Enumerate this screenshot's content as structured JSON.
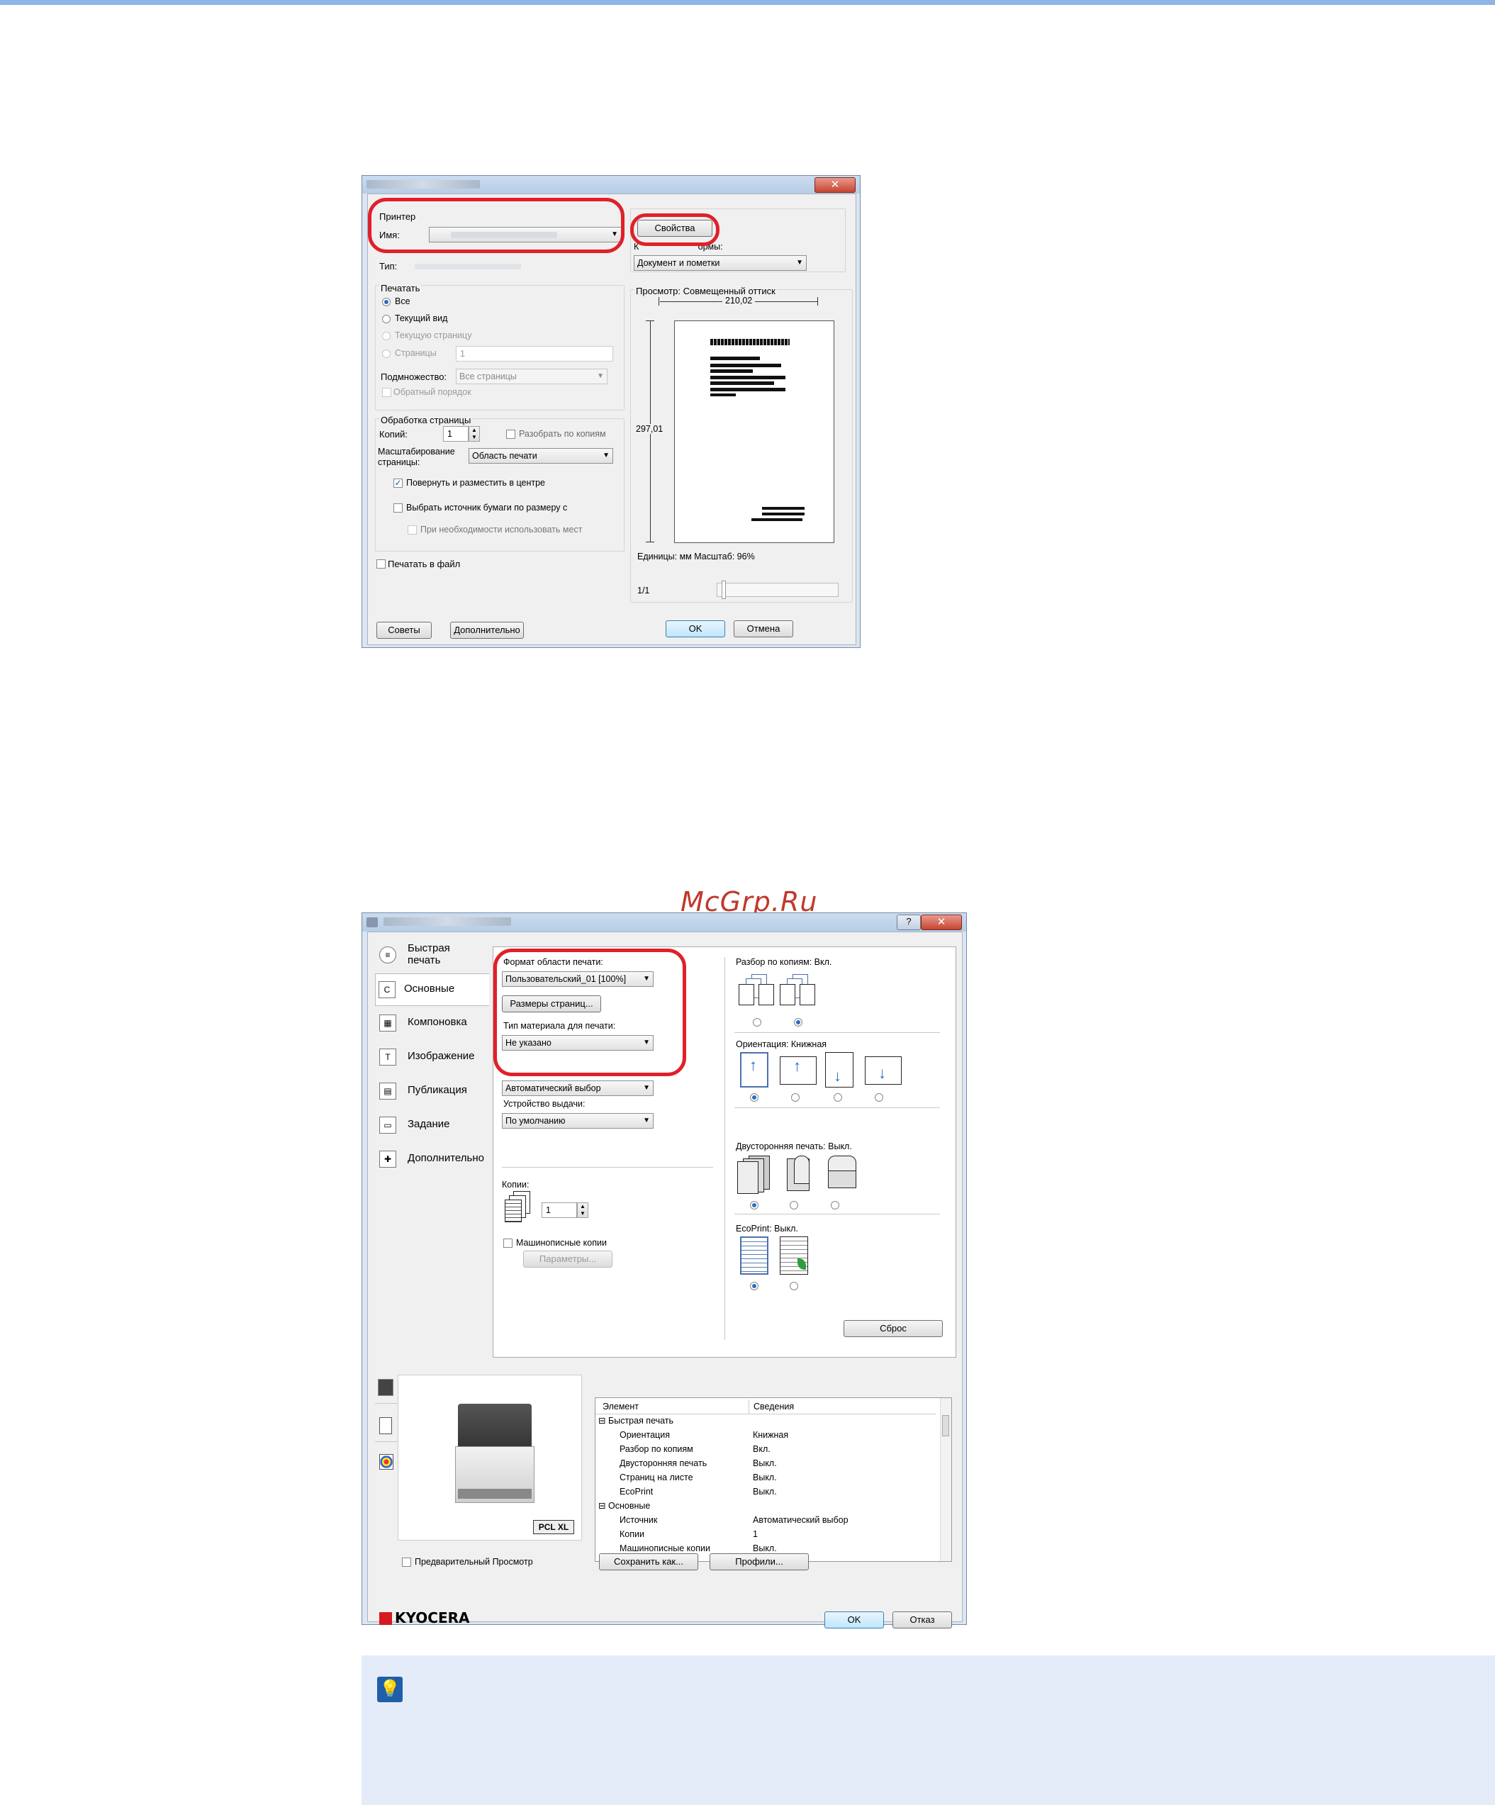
{
  "watermark": "McGrp.Ru",
  "print_dialog": {
    "printer_group": "Принтер",
    "name_label": "Имя:",
    "type_label": "Тип:",
    "properties_button": "Свойства",
    "comments_label_fragment": "К                        ормы:",
    "comments_value": "Документ и пометки",
    "print_range_group": "Печатать",
    "radio_all": "Все",
    "radio_current_view": "Текущий вид",
    "radio_current_page": "Текущую страницу",
    "radio_pages": "Страницы",
    "pages_value": "1",
    "subset_label": "Подмножество:",
    "subset_value": "Все страницы",
    "reverse_order": "Обратный порядок",
    "page_handling_group": "Обработка страницы",
    "copies_label": "Копий:",
    "copies_value": "1",
    "collate": "Разобрать по копиям",
    "scaling_label": "Масштабирование страницы:",
    "scaling_value": "Область печати",
    "auto_rotate": "Повернуть и разместить в центре",
    "choose_paper_source": "Выбрать источник бумаги по размеру с",
    "use_custom_size": "При необходимости использовать мест",
    "print_to_file": "Печатать в файл",
    "preview_label": "Просмотр: Совмещенный оттиск",
    "width_dim": "210,02",
    "height_dim": "297,01",
    "units_zoom": "Единицы: мм Масштаб:  96%",
    "page_counter": "1/1",
    "tips_button": "Советы",
    "advanced_button": "Дополнительно",
    "ok_button": "OK",
    "cancel_button": "Отмена"
  },
  "driver_dialog": {
    "help_button": "?",
    "close_button": "x",
    "tabs": [
      {
        "label": "Быстрая печать",
        "icon": "quick-print-icon"
      },
      {
        "label": "Основные",
        "icon": "basic-icon"
      },
      {
        "label": "Компоновка",
        "icon": "layout-icon"
      },
      {
        "label": "Изображение",
        "icon": "imaging-icon"
      },
      {
        "label": "Публикация",
        "icon": "publishing-icon"
      },
      {
        "label": "Задание",
        "icon": "job-icon"
      },
      {
        "label": "Дополнительно",
        "icon": "advanced-icon"
      }
    ],
    "print_size_label": "Формат области печати:",
    "print_size_value": "Пользовательский_01 [100%]",
    "page_sizes_button": "Размеры страниц...",
    "media_type_label": "Тип материала для печати:",
    "media_type_value": "Не указано",
    "source_value": "Автоматический выбор",
    "output_label": "Устройство выдачи:",
    "output_value": "По умолчанию",
    "copies_label": "Копии:",
    "copies_value": "1",
    "carbon_copies": "Машинописные копии",
    "parameters_button": "Параметры...",
    "collate_label": "Разбор по копиям:  Вкл.",
    "orientation_label": "Ориентация:  Книжная",
    "duplex_label": "Двусторонняя печать:  Выкл.",
    "ecoprint_label": "EcoPrint:  Выкл.",
    "reset_button": "Сброс",
    "pcl_badge": "PCL XL",
    "table_header": {
      "item": "Элемент",
      "details": "Сведения"
    },
    "table_rows": [
      {
        "item": "Быстрая печать",
        "details": "",
        "group": true
      },
      {
        "item": "Ориентация",
        "details": "Книжная"
      },
      {
        "item": "Разбор по копиям",
        "details": "Вкл."
      },
      {
        "item": "Двусторонняя печать",
        "details": "Выкл."
      },
      {
        "item": "Страниц на листе",
        "details": "Выкл."
      },
      {
        "item": "EcoPrint",
        "details": "Выкл."
      },
      {
        "item": "Основные",
        "details": "",
        "group": true
      },
      {
        "item": "Источник",
        "details": "Автоматический выбор"
      },
      {
        "item": "Копии",
        "details": "1"
      },
      {
        "item": "Машинописные копии",
        "details": "Выкл."
      }
    ],
    "preview_checkbox": "Предварительный Просмотр",
    "save_as_button": "Сохранить как...",
    "profiles_button": "Профили...",
    "brand": "KYOCERA",
    "ok_button": "OK",
    "cancel_button": "Отказ"
  }
}
